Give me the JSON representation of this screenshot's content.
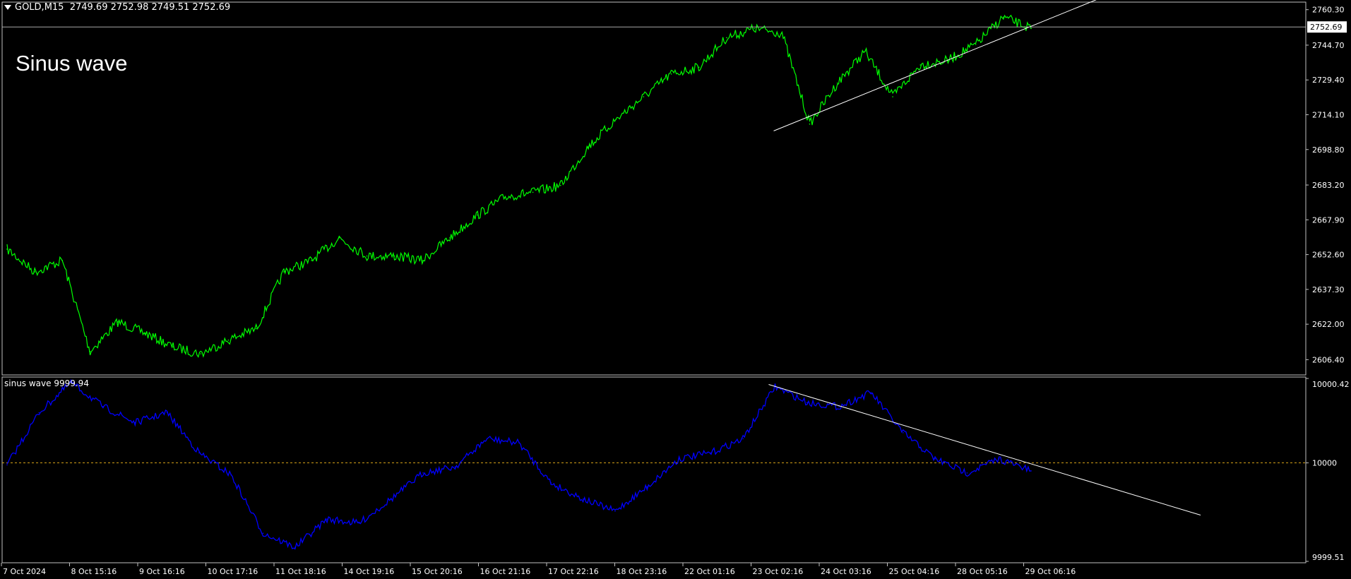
{
  "header": {
    "symbol": "GOLD,M15",
    "ohlc": "2749.69 2752.98 2749.51 2752.69"
  },
  "overlay_text": "Sinus wave",
  "indicator_panel": {
    "label": "sinus wave 9999.94"
  },
  "colors": {
    "background": "#000000",
    "price_line": "#00ff00",
    "indicator_line": "#0000ff",
    "level_line": "#d4a017",
    "trendline": "#ffffff",
    "frame": "#c0c0c0"
  },
  "chart_data": [
    {
      "type": "line",
      "title": "GOLD,M15",
      "series": [
        {
          "name": "GOLD,M15",
          "x": [
            "7 Oct 2024",
            "7 Oct 2024 12:00",
            "8 Oct 15:16",
            "8 Oct 18:00",
            "8 Oct 22:00",
            "9 Oct 06:00",
            "9 Oct 16:16",
            "9 Oct 22:00",
            "10 Oct 06:00",
            "10 Oct 17:16",
            "10 Oct 22:00",
            "11 Oct 06:00",
            "11 Oct 18:16",
            "11 Oct 22:00",
            "14 Oct 06:00",
            "14 Oct 19:16",
            "15 Oct 06:00",
            "15 Oct 20:16",
            "16 Oct 06:00",
            "16 Oct 21:16",
            "17 Oct 06:00",
            "17 Oct 22:16",
            "18 Oct 06:00",
            "18 Oct 23:16",
            "21 Oct 06:00",
            "22 Oct 01:16",
            "22 Oct 12:00",
            "23 Oct 02:16",
            "23 Oct 06:00",
            "23 Oct 09:00",
            "24 Oct 03:16",
            "24 Oct 12:00",
            "25 Oct 04:16",
            "25 Oct 12:00",
            "28 Oct 05:16",
            "28 Oct 12:00",
            "29 Oct 06:16",
            "29 Oct 09:00"
          ],
          "values": [
            2655,
            2645,
            2650,
            2610,
            2623,
            2618,
            2612,
            2609,
            2615,
            2620,
            2645,
            2650,
            2660,
            2652,
            2652,
            2650,
            2660,
            2670,
            2678,
            2680,
            2683,
            2700,
            2712,
            2722,
            2732,
            2735,
            2748,
            2752,
            2750,
            2710,
            2728,
            2742,
            2722,
            2736,
            2738,
            2745,
            2757,
            2752
          ]
        }
      ],
      "ylim": [
        2600.0,
        2763.0
      ],
      "y_ticks": [
        "2760.30",
        "2744.70",
        "2729.40",
        "2714.10",
        "2698.80",
        "2683.20",
        "2667.90",
        "2652.60",
        "2637.30",
        "2622.00",
        "2606.40"
      ],
      "current_price": "2752.69",
      "trendline": {
        "from": [
          "23 Oct 05:00",
          2707.0
        ],
        "to": [
          "29 Oct 14:00",
          2765.0
        ]
      },
      "grid": false,
      "legend": "none"
    },
    {
      "type": "line",
      "title": "sinus wave 9999.94",
      "series": [
        {
          "name": "sinus wave",
          "x": [
            "7 Oct 2024",
            "7 Oct 2024 12:00",
            "8 Oct 15:16",
            "8 Oct 18:00",
            "9 Oct 06:00",
            "9 Oct 16:16",
            "10 Oct 06:00",
            "10 Oct 17:16",
            "11 Oct 06:00",
            "11 Oct 18:16",
            "14 Oct 06:00",
            "14 Oct 19:16",
            "15 Oct 06:00",
            "15 Oct 20:16",
            "16 Oct 06:00",
            "16 Oct 21:16",
            "17 Oct 06:00",
            "17 Oct 22:16",
            "18 Oct 06:00",
            "18 Oct 23:16",
            "21 Oct 06:00",
            "22 Oct 01:16",
            "22 Oct 12:00",
            "23 Oct 02:16",
            "23 Oct 06:00",
            "24 Oct 03:16",
            "24 Oct 12:00",
            "25 Oct 04:16",
            "25 Oct 12:00",
            "28 Oct 05:16",
            "28 Oct 12:00",
            "29 Oct 06:16",
            "29 Oct 09:00"
          ],
          "values": [
            9999.99,
            10000.25,
            10000.4,
            10000.28,
            10000.2,
            10000.25,
            10000.05,
            9999.94,
            9999.65,
            9999.58,
            9999.72,
            9999.7,
            9999.82,
            9999.95,
            9999.98,
            10000.12,
            10000.1,
            9999.9,
            9999.82,
            9999.76,
            9999.88,
            10000.02,
            10000.05,
            10000.12,
            10000.38,
            10000.3,
            10000.28,
            10000.35,
            10000.15,
            10000.02,
            9999.95,
            10000.02,
            9999.96
          ]
        }
      ],
      "ylim": [
        9999.51,
        10000.42
      ],
      "y_ticks": [
        "10000.42",
        "10000",
        "9999.51"
      ],
      "level_line": 10000,
      "trendline": {
        "from": [
          "23 Oct 05:00",
          10000.39
        ],
        "to": [
          "31 Oct 12:00",
          9999.74
        ]
      },
      "grid": false,
      "legend": "none"
    }
  ],
  "x_axis": {
    "tick_labels": [
      "7 Oct 2024",
      "8 Oct 15:16",
      "9 Oct 16:16",
      "10 Oct 17:16",
      "11 Oct 18:16",
      "14 Oct 19:16",
      "15 Oct 20:16",
      "16 Oct 21:16",
      "17 Oct 22:16",
      "18 Oct 23:16",
      "22 Oct 01:16",
      "23 Oct 02:16",
      "24 Oct 03:16",
      "25 Oct 04:16",
      "28 Oct 05:16",
      "29 Oct 06:16"
    ]
  }
}
